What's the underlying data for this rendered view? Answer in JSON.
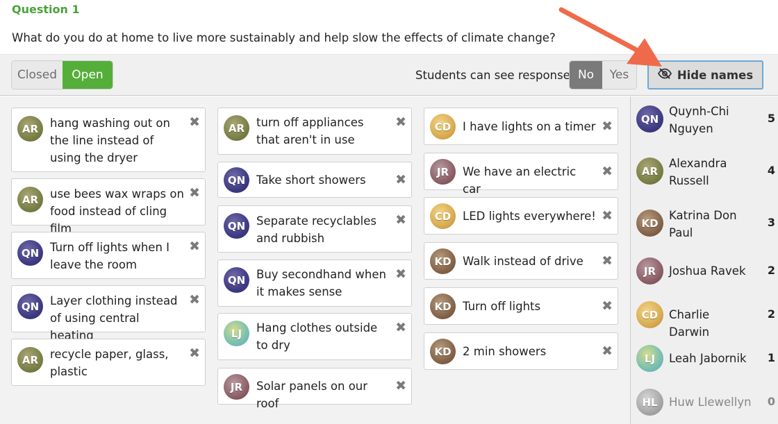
{
  "question": {
    "title": "Question 1",
    "text": "What do you do at home to live more sustainably and help slow the effects of climate change?"
  },
  "controls": {
    "status_closed": "Closed",
    "status_open": "Open",
    "status_selected": "Open",
    "students_label": "Students can see responses",
    "visibility_no": "No",
    "visibility_yes": "Yes",
    "visibility_selected": "No",
    "hide_names": "Hide names"
  },
  "colors": {
    "accent_green": "#55ae3a",
    "title_green": "#4aa33a",
    "arrow_orange": "#ef6a4a"
  },
  "responses": [
    [
      {
        "initials": "AR",
        "text": "hang washing out on the line instead of using the dryer"
      },
      {
        "initials": "AR",
        "text": "use bees wax wraps on food instead of cling film"
      },
      {
        "initials": "QN",
        "text": "Turn off lights when I leave the room"
      },
      {
        "initials": "QN",
        "text": "Layer clothing instead of using central heating"
      },
      {
        "initials": "AR",
        "text": "recycle paper, glass, plastic"
      }
    ],
    [
      {
        "initials": "AR",
        "text": "turn off appliances that aren't in use"
      },
      {
        "initials": "QN",
        "text": "Take short showers"
      },
      {
        "initials": "QN",
        "text": "Separate recyclables and rubbish"
      },
      {
        "initials": "QN",
        "text": "Buy secondhand when it makes sense"
      },
      {
        "initials": "LJ",
        "text": "Hang clothes outside to dry"
      },
      {
        "initials": "JR",
        "text": "Solar panels on our roof"
      }
    ],
    [
      {
        "initials": "CD",
        "text": "I have lights on a timer"
      },
      {
        "initials": "JR",
        "text": "We have an electric car"
      },
      {
        "initials": "CD",
        "text": "LED lights everywhere!"
      },
      {
        "initials": "KD",
        "text": "Walk instead of drive"
      },
      {
        "initials": "KD",
        "text": "Turn off lights"
      },
      {
        "initials": "KD",
        "text": "2 min showers"
      }
    ]
  ],
  "students": [
    {
      "initials": "QN",
      "name": "Quynh-Chi Nguyen",
      "count": "5"
    },
    {
      "initials": "AR",
      "name": "Alexandra Russell",
      "count": "4"
    },
    {
      "initials": "KD",
      "name": "Katrina Don Paul",
      "count": "3"
    },
    {
      "initials": "JR",
      "name": "Joshua Ravek",
      "count": "2"
    },
    {
      "initials": "CD",
      "name": "Charlie Darwin",
      "count": "2"
    },
    {
      "initials": "LJ",
      "name": "Leah Jabornik",
      "count": "1"
    },
    {
      "initials": "HL",
      "name": "Huw Llewellyn",
      "count": "0"
    }
  ],
  "icons": {
    "hide": "eye-slash-icon",
    "remove": "close-icon"
  }
}
